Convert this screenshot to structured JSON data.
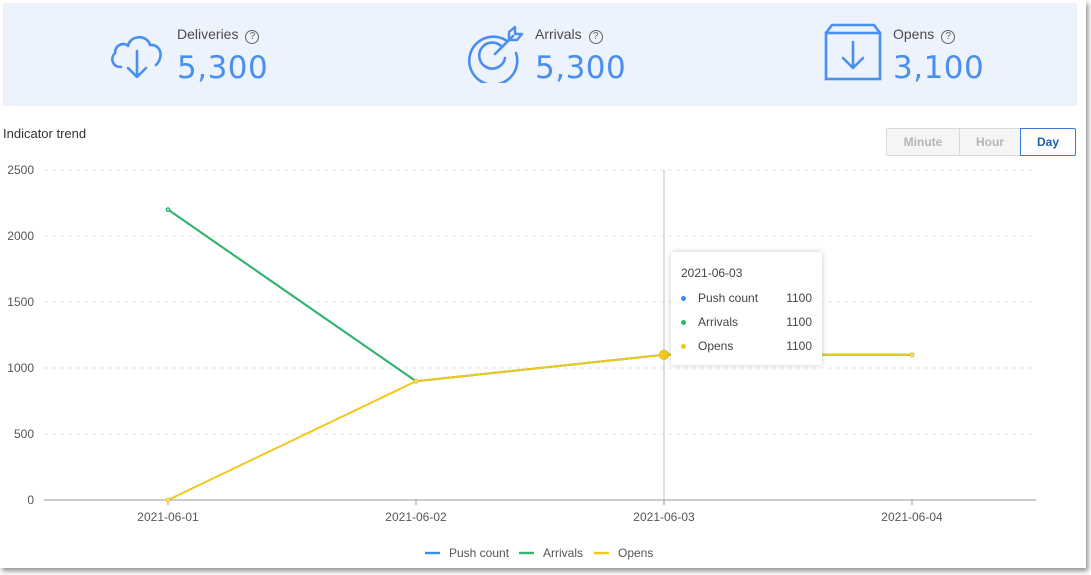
{
  "stats": [
    {
      "label": "Deliveries",
      "value": "5,300",
      "icon": "cloud-download-icon"
    },
    {
      "label": "Arrivals",
      "value": "5,300",
      "icon": "target-arrow-icon"
    },
    {
      "label": "Opens",
      "value": "3,100",
      "icon": "inbox-download-icon"
    }
  ],
  "help_glyph": "?",
  "section_title": "Indicator trend",
  "granularity": {
    "options": [
      "Minute",
      "Hour",
      "Day"
    ],
    "selected": "Day"
  },
  "colors": {
    "accent": "#4a8ff0",
    "push_count": "#3b8fe8",
    "arrivals": "#32b768",
    "opens": "#f2c81c",
    "banner_bg": "#ecf3fd"
  },
  "chart_data": {
    "type": "line",
    "title": "",
    "xlabel": "",
    "ylabel": "",
    "x": [
      "2021-06-01",
      "2021-06-02",
      "2021-06-03",
      "2021-06-04"
    ],
    "ylim": [
      0,
      2500
    ],
    "yticks": [
      0,
      500,
      1000,
      1500,
      2000,
      2500
    ],
    "grid": true,
    "legend_position": "bottom-center",
    "series": [
      {
        "name": "Push count",
        "values": [
          2200,
          900,
          1100,
          1100
        ]
      },
      {
        "name": "Arrivals",
        "values": [
          2200,
          900,
          1100,
          1100
        ]
      },
      {
        "name": "Opens",
        "values": [
          0,
          900,
          1100,
          1100
        ]
      }
    ],
    "tooltip": {
      "x": "2021-06-03",
      "rows": [
        {
          "name": "Push count",
          "value": "1100"
        },
        {
          "name": "Arrivals",
          "value": "1100"
        },
        {
          "name": "Opens",
          "value": "1100"
        }
      ]
    }
  }
}
